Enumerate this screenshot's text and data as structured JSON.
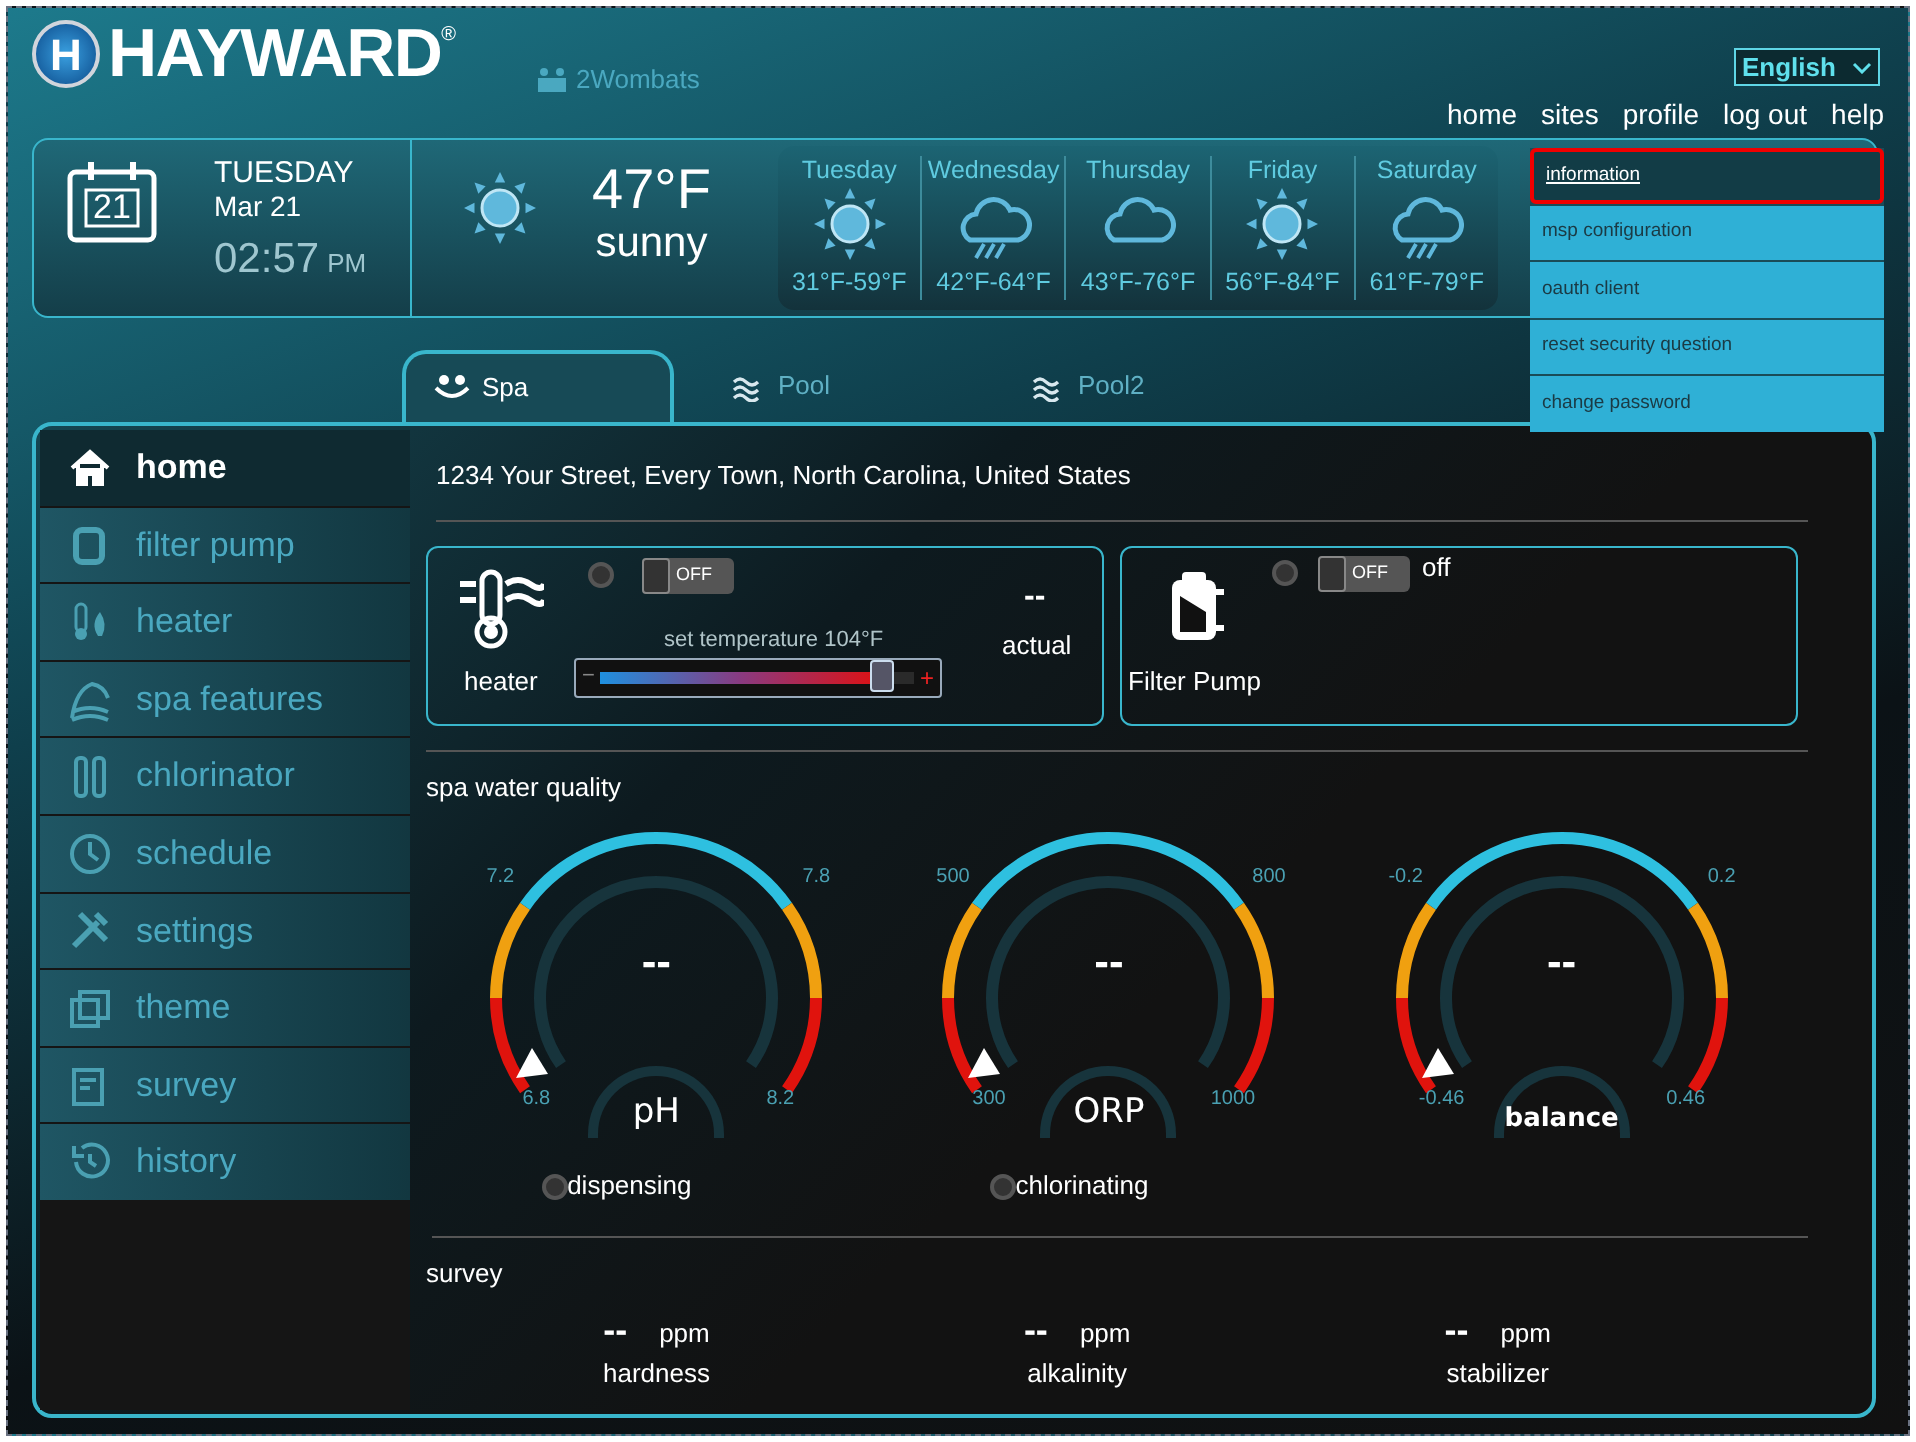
{
  "brand": {
    "logo_letter": "H",
    "name": "HAYWARD",
    "mark": "®",
    "site": "2Wombats"
  },
  "language": {
    "value": "English"
  },
  "nav": [
    "home",
    "sites",
    "profile",
    "log out",
    "help"
  ],
  "date": {
    "calendar_day": "21",
    "weekday": "TUESDAY",
    "date": "Mar 21",
    "time": "02:57",
    "ampm": "PM"
  },
  "weather": {
    "temperature": "47°F",
    "condition": "sunny"
  },
  "forecast": [
    {
      "day": "Tuesday",
      "kind": "sun",
      "range": "31°F-59°F"
    },
    {
      "day": "Wednesday",
      "kind": "rain",
      "range": "42°F-64°F"
    },
    {
      "day": "Thursday",
      "kind": "cloud",
      "range": "43°F-76°F"
    },
    {
      "day": "Friday",
      "kind": "sun",
      "range": "56°F-84°F"
    },
    {
      "day": "Saturday",
      "kind": "rain",
      "range": "61°F-79°F"
    }
  ],
  "profile_menu": [
    {
      "label": "information",
      "selected": true
    },
    {
      "label": "msp configuration",
      "selected": false
    },
    {
      "label": "oauth client",
      "selected": false
    },
    {
      "label": "reset security question",
      "selected": false
    },
    {
      "label": "change password",
      "selected": false
    }
  ],
  "tabs": [
    {
      "label": "Spa",
      "selected": true
    },
    {
      "label": "Pool",
      "selected": false
    },
    {
      "label": "Pool2",
      "selected": false
    }
  ],
  "sidebar": {
    "items": [
      {
        "label": "home",
        "selected": true
      },
      {
        "label": "filter pump",
        "selected": false
      },
      {
        "label": "heater",
        "selected": false
      },
      {
        "label": "spa features",
        "selected": false
      },
      {
        "label": "chlorinator",
        "selected": false
      },
      {
        "label": "schedule",
        "selected": false
      },
      {
        "label": "settings",
        "selected": false
      },
      {
        "label": "theme",
        "selected": false
      },
      {
        "label": "survey",
        "selected": false
      },
      {
        "label": "history",
        "selected": false
      }
    ]
  },
  "address": "1234 Your Street, Every Town, North Carolina, United States",
  "heater": {
    "label": "heater",
    "on": false,
    "toggle": "OFF",
    "setpoint": "set temperature 104°F",
    "minus": "−",
    "plus": "+",
    "level": 0.9,
    "actual_value": "--",
    "actual_label": "actual"
  },
  "filter_pump": {
    "label": "Filter Pump",
    "on": false,
    "toggle": "OFF",
    "status": "off"
  },
  "water_quality": {
    "title": "spa water quality",
    "gauges": [
      {
        "name": "pH",
        "value": "--",
        "min": "6.8",
        "low": "7.2",
        "high": "7.8",
        "max": "8.2",
        "indicator": "dispensing",
        "active": false
      },
      {
        "name": "ORP",
        "value": "--",
        "min": "300",
        "low": "500",
        "high": "800",
        "max": "1000",
        "indicator": "chlorinating",
        "active": false
      },
      {
        "name": "balance",
        "value": "--",
        "min": "-0.46",
        "low": "-0.2",
        "high": "0.2",
        "max": "0.46"
      }
    ]
  },
  "survey": {
    "title": "survey",
    "items": [
      {
        "value": "--",
        "unit": "ppm",
        "label": "hardness"
      },
      {
        "value": "--",
        "unit": "ppm",
        "label": "alkalinity"
      },
      {
        "value": "--",
        "unit": "ppm",
        "label": "stabilizer"
      }
    ]
  }
}
